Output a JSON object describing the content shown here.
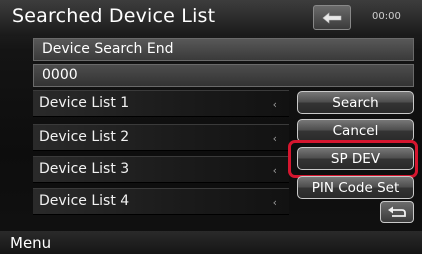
{
  "header": {
    "title": "Searched Device List",
    "clock": "00:00",
    "back_icon": "back-arrow-icon"
  },
  "status_text": "Device Search End",
  "pin_value": "0000",
  "devices": [
    {
      "label": "Device List 1"
    },
    {
      "label": "Device List 2"
    },
    {
      "label": "Device List 3"
    },
    {
      "label": "Device List 4"
    }
  ],
  "buttons": {
    "search": "Search",
    "cancel": "Cancel",
    "sp_dev": "SP DEV",
    "pin_code_set": "PIN Code Set",
    "return_icon": "return-icon"
  },
  "footer": {
    "menu": "Menu"
  },
  "colors": {
    "highlight": "#d5162f"
  }
}
